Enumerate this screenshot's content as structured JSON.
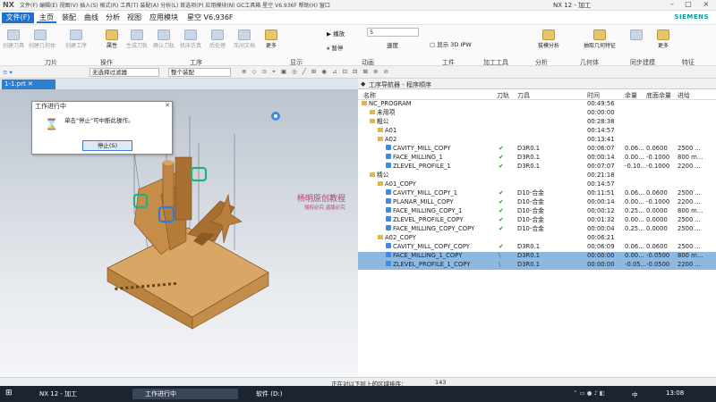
{
  "titlebar": {
    "app_logo": "NX",
    "quick_access": "文件(F)  编辑(E)  视图(V)  插入(S)  格式(R)  工具(T)  装配(A)  分析(L)  首选项(P)  应用模块(N)  GC工具箱  星空 V6.936F  帮助(H)  窗口",
    "window_title": "NX 12 - 加工",
    "brand": "SIEMENS"
  },
  "menubar": {
    "file": "文件(F)",
    "items": [
      "主页",
      "装配",
      "曲线",
      "分析",
      "视图",
      "应用模块",
      "星空 V6.936F"
    ]
  },
  "ribbon": {
    "tools": [
      "创建刀具",
      "创建几何体",
      "创建工序",
      "属性",
      "生成刀轨",
      "确认刀轨",
      "机床仿真",
      "后处理",
      "车间文档",
      "更多"
    ],
    "animation": {
      "play": "播放",
      "pause": "暂停",
      "speed_value": "5",
      "speed_label": "速度"
    },
    "display": {
      "ipw": "显示 3D IPW",
      "extract": "拔模分析",
      "extract_geo": "抽取几何特征",
      "more": "更多"
    },
    "groups": [
      "刀片",
      "操作",
      "工序",
      "显示",
      "动画",
      "工件",
      "加工工具",
      "分析",
      "几何体",
      "同步建模",
      "特征"
    ]
  },
  "toolbar2": {
    "filter": "无选择过滤器",
    "assembly": "整个装配"
  },
  "viewport_tab": "1-1.prt",
  "dialog": {
    "title": "工作进行中",
    "message": "单击\"停止\"可中断此操作。",
    "stop_button": "停止(S)"
  },
  "navigator": {
    "title": "工序导航器 - 程序顺序",
    "columns": [
      "名称",
      "刀轨",
      "刀具",
      "时间",
      "余量",
      "底面余量",
      "进给"
    ],
    "rows": [
      {
        "name": "NC_PROGRAM",
        "indent": 0,
        "kind": "root",
        "chk": "",
        "tool": "",
        "time": "00:49:56",
        "stock": "",
        "floor": "",
        "feed": ""
      },
      {
        "name": "未用项",
        "indent": 1,
        "kind": "folder",
        "chk": "",
        "tool": "",
        "time": "00:00:00",
        "stock": "",
        "floor": "",
        "feed": ""
      },
      {
        "name": "粗公",
        "indent": 1,
        "kind": "folder",
        "chk": "",
        "tool": "",
        "time": "00:28:38",
        "stock": "",
        "floor": "",
        "feed": ""
      },
      {
        "name": "A01",
        "indent": 2,
        "kind": "folder",
        "chk": "",
        "tool": "",
        "time": "00:14:57",
        "stock": "",
        "floor": "",
        "feed": ""
      },
      {
        "name": "A02",
        "indent": 2,
        "kind": "folder",
        "chk": "",
        "tool": "",
        "time": "00:13:41",
        "stock": "",
        "floor": "",
        "feed": ""
      },
      {
        "name": "CAVITY_MILL_COPY",
        "indent": 3,
        "kind": "op",
        "chk": "✔",
        "tool": "D3R0.1",
        "time": "00:06:07",
        "stock": "0.06...",
        "floor": "0.0600",
        "feed": "2500 ..."
      },
      {
        "name": "FACE_MILLING_1",
        "indent": 3,
        "kind": "op",
        "chk": "✔",
        "tool": "D3R0.1",
        "time": "00:00:14",
        "stock": "0.00...",
        "floor": "-0.1000",
        "feed": "800 m..."
      },
      {
        "name": "ZLEVEL_PROFILE_1",
        "indent": 3,
        "kind": "op",
        "chk": "✔",
        "tool": "D3R0.1",
        "time": "00:07:07",
        "stock": "-0.10...",
        "floor": "-0.1000",
        "feed": "2200 ..."
      },
      {
        "name": "精公",
        "indent": 1,
        "kind": "folder",
        "chk": "",
        "tool": "",
        "time": "00:21:18",
        "stock": "",
        "floor": "",
        "feed": ""
      },
      {
        "name": "A01_COPY",
        "indent": 2,
        "kind": "folder",
        "chk": "",
        "tool": "",
        "time": "00:14:57",
        "stock": "",
        "floor": "",
        "feed": ""
      },
      {
        "name": "CAVITY_MILL_COPY_1",
        "indent": 3,
        "kind": "op",
        "chk": "✔",
        "tool": "D10-合金",
        "time": "00:11:51",
        "stock": "0.06...",
        "floor": "0.0600",
        "feed": "2500 ..."
      },
      {
        "name": "PLANAR_MILL_COPY",
        "indent": 3,
        "kind": "op",
        "chk": "✔",
        "tool": "D10-合金",
        "time": "00:00:14",
        "stock": "0.00...",
        "floor": "-0.1000",
        "feed": "2200 ..."
      },
      {
        "name": "FACE_MILLING_COPY_1",
        "indent": 3,
        "kind": "op",
        "chk": "✔",
        "tool": "D10-合金",
        "time": "00:00:12",
        "stock": "0.25...",
        "floor": "0.0000",
        "feed": "800 m..."
      },
      {
        "name": "ZLEVEL_PROFILE_COPY",
        "indent": 3,
        "kind": "op",
        "chk": "✔",
        "tool": "D10-合金",
        "time": "00:01:32",
        "stock": "0.00...",
        "floor": "0.0000",
        "feed": "2500 ..."
      },
      {
        "name": "FACE_MILLING_COPY_COPY",
        "indent": 3,
        "kind": "op",
        "chk": "✔",
        "tool": "D10-合金",
        "time": "00:00:04",
        "stock": "0.25...",
        "floor": "0.0000",
        "feed": "2500 ..."
      },
      {
        "name": "A02_COPY",
        "indent": 2,
        "kind": "folder",
        "chk": "",
        "tool": "",
        "time": "00:06:21",
        "stock": "",
        "floor": "",
        "feed": ""
      },
      {
        "name": "CAVITY_MILL_COPY_COPY",
        "indent": 3,
        "kind": "op",
        "chk": "✔",
        "tool": "D3R0.1",
        "time": "00:06:09",
        "stock": "0.06...",
        "floor": "0.0600",
        "feed": "2500 ..."
      },
      {
        "name": "FACE_MILLING_1_COPY",
        "indent": 3,
        "kind": "op",
        "chk": "\\",
        "tool": "D3R0.1",
        "time": "00:00:00",
        "stock": "0.00...",
        "floor": "-0.0500",
        "feed": "800 m...",
        "selected": true
      },
      {
        "name": "ZLEVEL_PROFILE_1_COPY",
        "indent": 3,
        "kind": "op",
        "chk": "\\",
        "tool": "D3R0.1",
        "time": "00:00:00",
        "stock": "-0.05...",
        "floor": "-0.0500",
        "feed": "2200 ...",
        "selected": true
      }
    ]
  },
  "watermark": {
    "line1": "杨明原创教程",
    "line2": "侵权必究 盗版必究"
  },
  "statusbar": {
    "text": "正在对以下层上的区域排序：",
    "count": "143"
  },
  "taskbar": {
    "items": [
      "NX 12 - 加工",
      "工作进行中",
      "软件 (D:)"
    ],
    "ime": "中",
    "clock": "13:08"
  },
  "colors": {
    "accent": "#1e6fd0",
    "selection": "#8fb8e0",
    "part": "#c8955a"
  }
}
